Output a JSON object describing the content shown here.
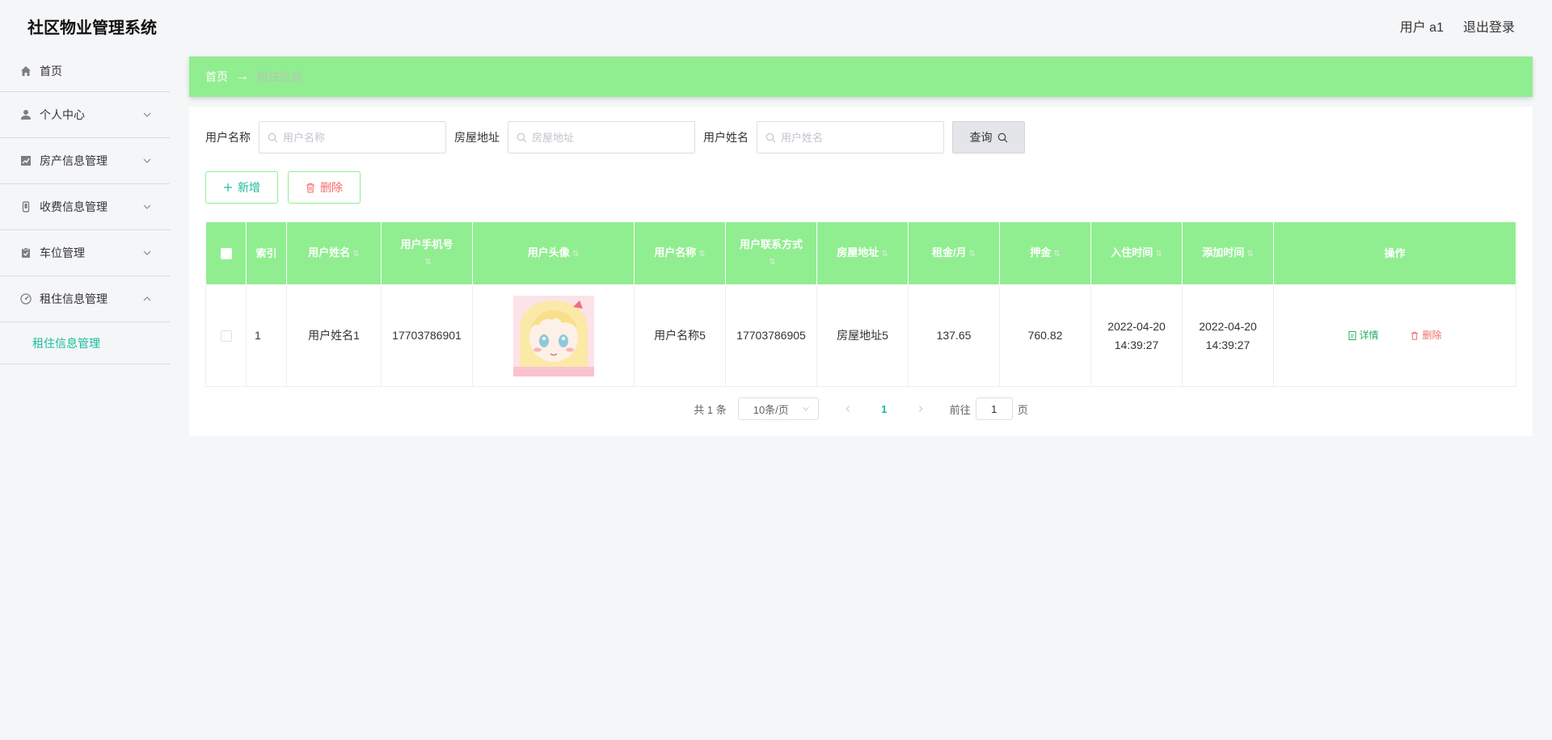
{
  "app": {
    "title": "社区物业管理系统"
  },
  "header": {
    "user_label": "用户 a1",
    "logout_label": "退出登录"
  },
  "sidebar": {
    "items": [
      {
        "label": "首页",
        "icon": "home-icon"
      },
      {
        "label": "个人中心",
        "icon": "user-icon"
      },
      {
        "label": "房产信息管理",
        "icon": "chart-icon"
      },
      {
        "label": "收费信息管理",
        "icon": "phone-icon"
      },
      {
        "label": "车位管理",
        "icon": "clipboard-icon"
      },
      {
        "label": "租住信息管理",
        "icon": "compass-icon"
      }
    ],
    "sub_item": "租住信息管理"
  },
  "breadcrumb": {
    "home": "首页",
    "separator": "→",
    "current": "租住信息"
  },
  "search": {
    "username_label": "用户名称",
    "username_placeholder": "用户名称",
    "address_label": "房屋地址",
    "address_placeholder": "房屋地址",
    "realname_label": "用户姓名",
    "realname_placeholder": "用户姓名",
    "query_label": "查询"
  },
  "actions": {
    "add_label": "新增",
    "delete_label": "删除"
  },
  "table": {
    "headers": {
      "index": "索引",
      "name": "用户姓名",
      "phone": "用户手机号",
      "avatar": "用户头像",
      "username": "用户名称",
      "contact": "用户联系方式",
      "address": "房屋地址",
      "rent": "租金/月",
      "deposit": "押金",
      "checkin": "入住时间",
      "added": "添加时间",
      "ops": "操作"
    },
    "rows": [
      {
        "index": "1",
        "name": "用户姓名1",
        "phone": "17703786901",
        "username": "用户名称5",
        "contact": "17703786905",
        "address": "房屋地址5",
        "rent": "137.65",
        "deposit": "760.82",
        "checkin": "2022-04-20 14:39:27",
        "added": "2022-04-20 14:39:27",
        "detail_label": "详情",
        "delete_label": "删除"
      }
    ]
  },
  "pager": {
    "total": "共 1 条",
    "size": "10条/页",
    "current": "1",
    "goto_prefix": "前往",
    "goto_value": "1",
    "goto_suffix": "页"
  },
  "colors": {
    "accent": "#90ee90",
    "teal": "#1abc9c",
    "danger": "#f56c6c"
  }
}
